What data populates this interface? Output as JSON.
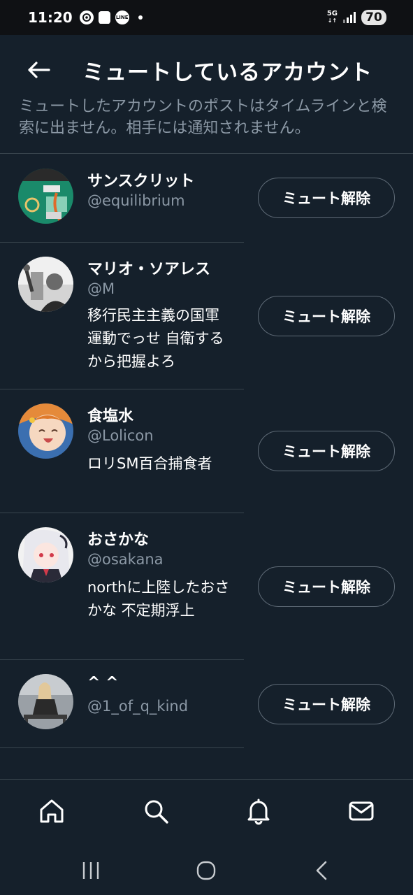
{
  "status_bar": {
    "time": "11:20",
    "icons": [
      "badge-icon",
      "shopping-bag-icon",
      "line-app-icon",
      "dot-icon"
    ],
    "line_label": "LINE",
    "network": "5G",
    "battery": "70"
  },
  "header": {
    "back_icon": "arrow-left-icon",
    "title": "ミュートしているアカウント",
    "subtitle": "ミュートしたアカウントのポストはタイムラインと検索に出ません。相手には通知されません。"
  },
  "accounts": [
    {
      "name": "サンスクリット",
      "handle": "@equilibrium",
      "bio": "",
      "button": "ミュート解除"
    },
    {
      "name": "マリオ・ソアレス",
      "handle": "@M",
      "bio": "移行民主主義の国軍運動でっせ 自衛するから把握よろ",
      "button": "ミュート解除"
    },
    {
      "name": "食塩水",
      "handle": "@Lolicon",
      "bio": "ロリSM百合捕食者",
      "button": "ミュート解除"
    },
    {
      "name": "おさかな",
      "handle": "@osakana",
      "bio": "northに上陸したおさかな 不定期浮上",
      "button": "ミュート解除"
    },
    {
      "name": "^ ^",
      "handle": "@1_of_q_kind",
      "bio": "",
      "button": "ミュート解除"
    }
  ],
  "bottom_nav": [
    "home-icon",
    "search-icon",
    "bell-icon",
    "mail-icon"
  ],
  "system_nav": [
    "recents-icon",
    "home-circle-icon",
    "back-chevron-icon"
  ],
  "colors": {
    "background": "#15202b",
    "muted_text": "#8b98a5",
    "divider": "#38444d",
    "button_border": "#5f6b77"
  }
}
